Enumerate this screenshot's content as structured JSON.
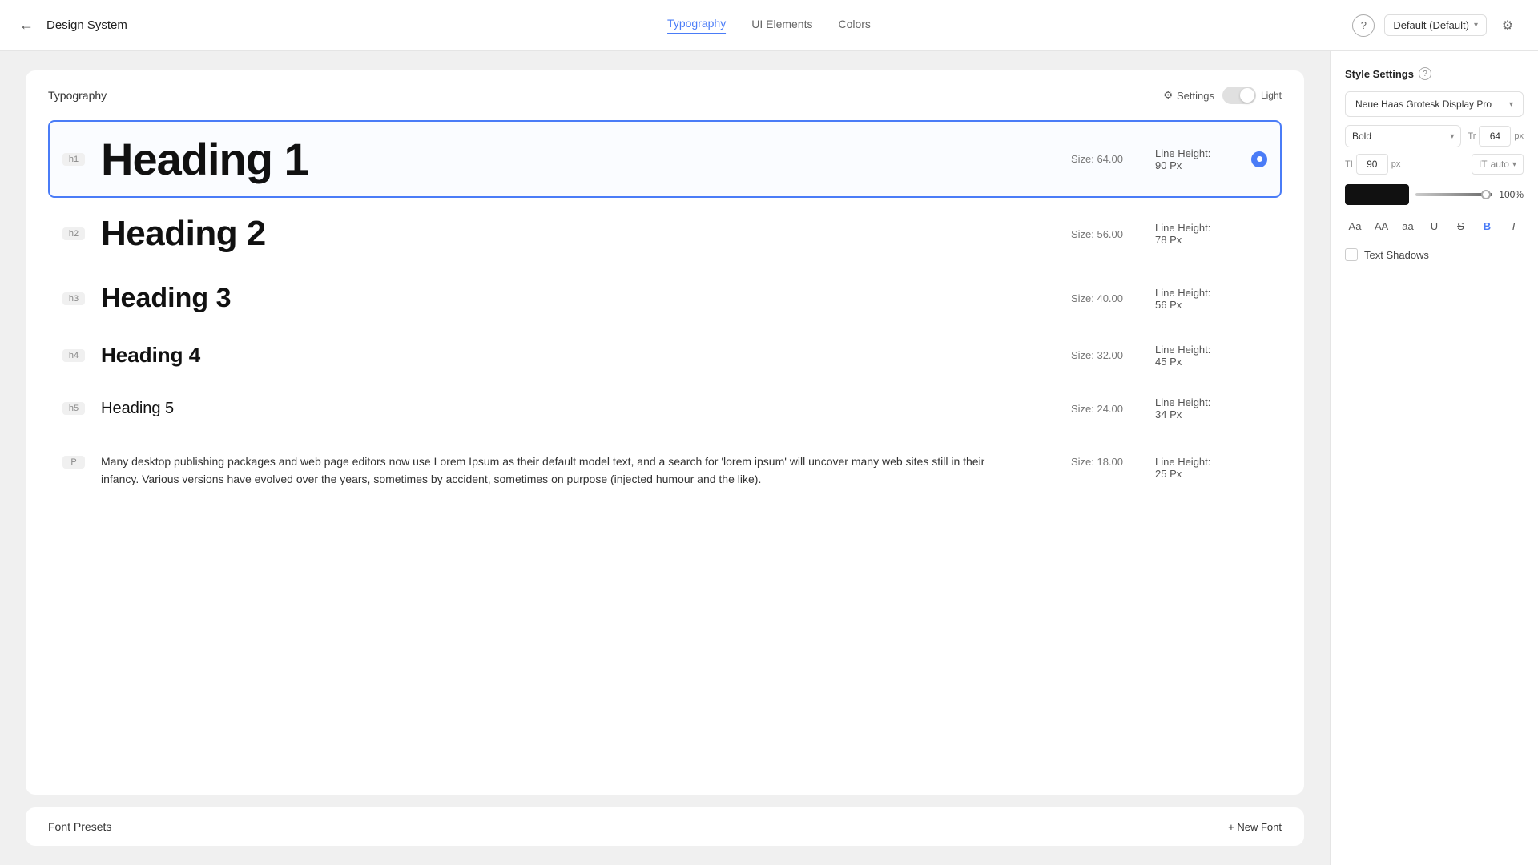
{
  "app": {
    "title": "Design System"
  },
  "nav": {
    "back_label": "←",
    "tabs": [
      {
        "id": "typography",
        "label": "Typography",
        "active": true
      },
      {
        "id": "ui-elements",
        "label": "UI Elements",
        "active": false
      },
      {
        "id": "colors",
        "label": "Colors",
        "active": false
      }
    ],
    "help_icon": "?",
    "dropdown_label": "Default (Default)",
    "settings_icon": "⚙"
  },
  "typography": {
    "section_title": "Typography",
    "settings_label": "Settings",
    "toggle_label": "Light",
    "headings": [
      {
        "tag": "h1",
        "text": "Heading 1",
        "size": "Size: 64.00",
        "line_height_label": "Line Height:",
        "line_height_value": "90 Px",
        "selected": true
      },
      {
        "tag": "h2",
        "text": "Heading 2",
        "size": "Size: 56.00",
        "line_height_label": "Line Height:",
        "line_height_value": "78 Px",
        "selected": false
      },
      {
        "tag": "h3",
        "text": "Heading 3",
        "size": "Size: 40.00",
        "line_height_label": "Line Height:",
        "line_height_value": "56 Px",
        "selected": false
      },
      {
        "tag": "h4",
        "text": "Heading 4",
        "size": "Size: 32.00",
        "line_height_label": "Line Height:",
        "line_height_value": "45 Px",
        "selected": false
      },
      {
        "tag": "h5",
        "text": "Heading 5",
        "size": "Size: 24.00",
        "line_height_label": "Line Height:",
        "line_height_value": "34 Px",
        "selected": false
      },
      {
        "tag": "P",
        "text": "Many desktop publishing packages and web page editors now use Lorem Ipsum as their default model text, and a search for 'lorem ipsum' will uncover many web sites still in their infancy. Various versions have evolved over the years, sometimes by accident, sometimes on purpose (injected humour and the like).",
        "size": "Size: 18.00",
        "line_height_label": "Line Height:",
        "line_height_value": "25 Px",
        "selected": false
      }
    ]
  },
  "font_presets": {
    "title": "Font Presets",
    "new_font_label": "+ New Font"
  },
  "style_settings": {
    "title": "Style Settings",
    "font_family": "Neue Haas Grotesk Display Pro",
    "weight_label": "Bold",
    "size_icon": "Tr",
    "size_value": "64",
    "size_unit": "px",
    "tracking_icon": "TI",
    "tracking_value": "90",
    "tracking_unit": "px",
    "leading_icon": "IT",
    "leading_value": "auto",
    "color_swatch": "#111111",
    "opacity_value": "100%",
    "text_style_buttons": [
      {
        "label": "Aa",
        "id": "small-aa"
      },
      {
        "label": "AA",
        "id": "large-aa"
      },
      {
        "label": "aa",
        "id": "lower-aa"
      },
      {
        "label": "U",
        "id": "underline",
        "style": "underline"
      },
      {
        "label": "S",
        "id": "strikethrough",
        "style": "strikethrough"
      },
      {
        "label": "B",
        "id": "bold",
        "active": true
      },
      {
        "label": "I",
        "id": "italic",
        "style": "italic"
      }
    ],
    "text_shadows_label": "Text Shadows"
  }
}
